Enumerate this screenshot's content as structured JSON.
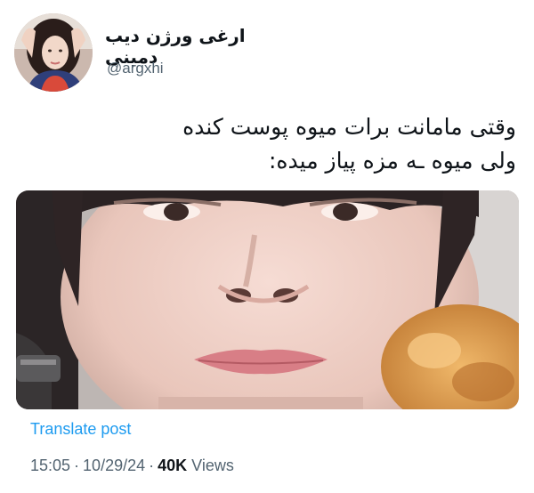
{
  "author": {
    "display_name": "ارغی ورژن دیب دمینی",
    "handle": "@argxhi",
    "avatar_icon": "profile-photo"
  },
  "tweet": {
    "lines": [
      "وقتی مامانت برات میوه پوست کنده",
      "ولی میوه ـه مزه پیاز میده:"
    ]
  },
  "media": {
    "icon": "photo-close-up-face-with-food"
  },
  "footer": {
    "translate_label": "Translate post",
    "time": "15:05",
    "separator": "·",
    "date": "10/29/24",
    "views_count": "40K",
    "views_label": "Views"
  },
  "colors": {
    "link": "#1d9bf0",
    "secondary_text": "#536471",
    "primary_text": "#0f1419"
  }
}
